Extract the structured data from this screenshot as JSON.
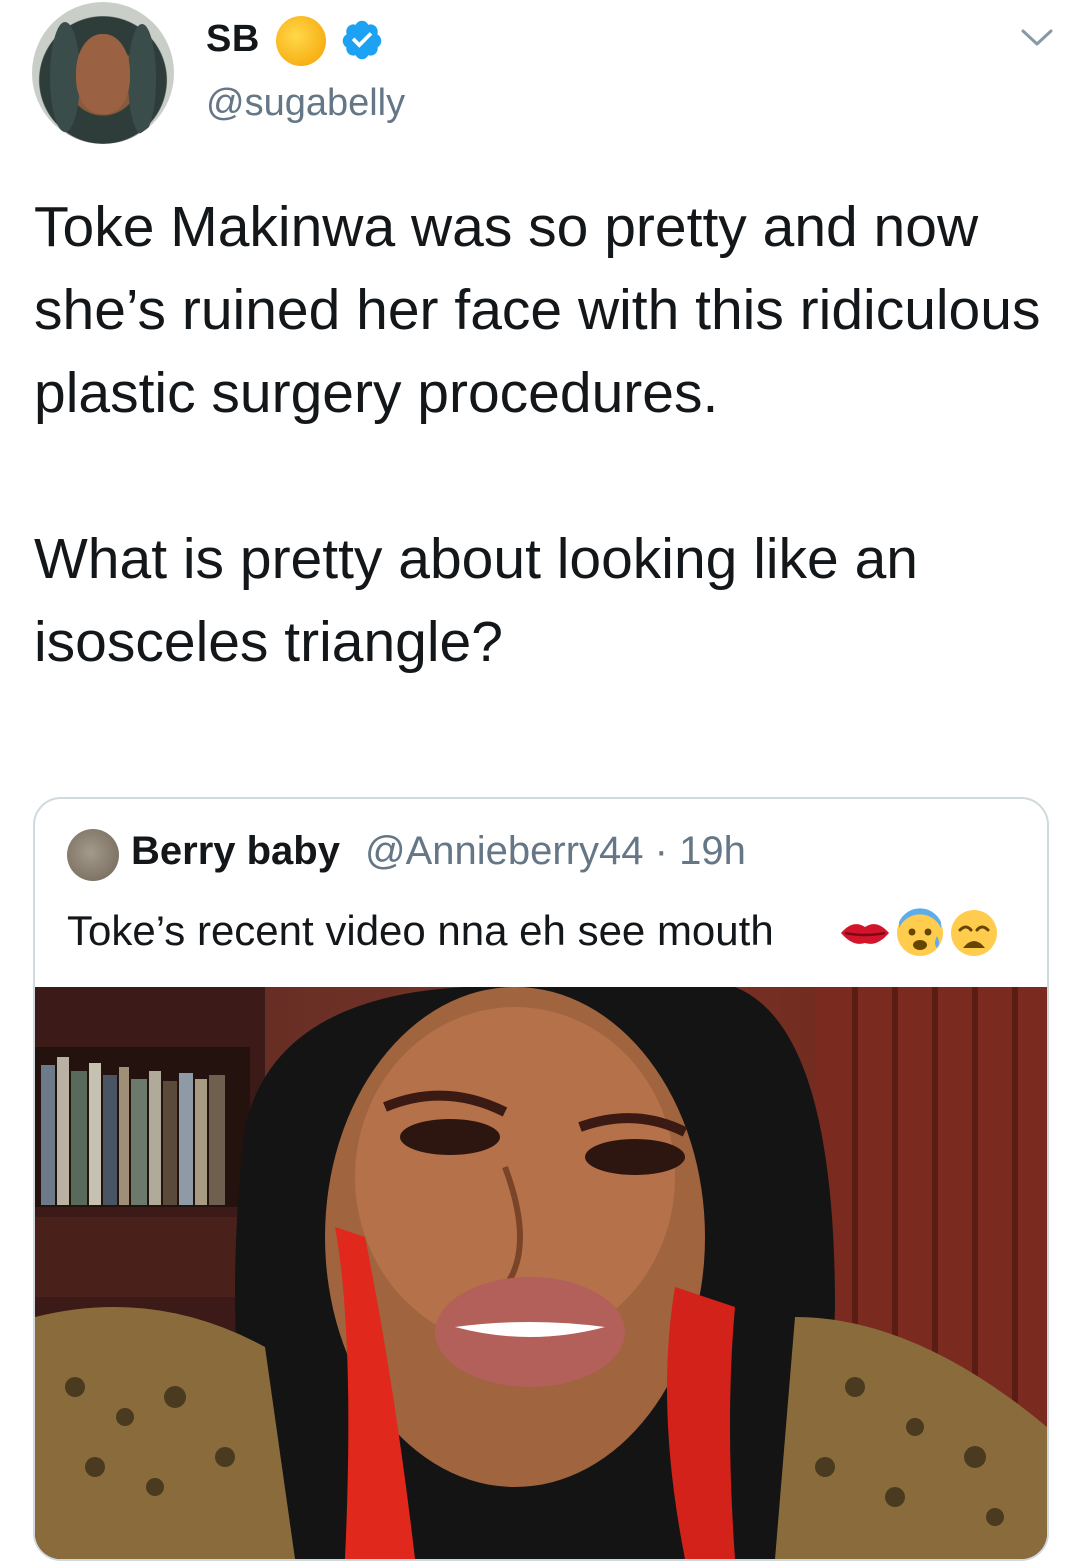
{
  "tweet": {
    "display_name": "SB",
    "handle": "@sugabelly",
    "text_para1": "Toke Makinwa was so pretty and now she’s ruined her face with this ridiculous plastic surgery procedures.",
    "text_para2": "What is pretty about looking like an isosceles triangle?",
    "icons": [
      "avatar-photo",
      "sun-badge-icon",
      "verified-icon",
      "chevron-down-icon"
    ]
  },
  "quote": {
    "display_name": "Berry baby",
    "handle_time": "@Annieberry44 · 19h",
    "text": "Toke’s recent video nna eh see mouth",
    "emojis": [
      "lips-emoji",
      "anxious-face-emoji",
      "weary-face-emoji"
    ],
    "media_icon": "video-still"
  },
  "colors": {
    "text": "#14171a",
    "secondary": "#657786",
    "verified": "#1da1f2",
    "border": "#cfd9de"
  }
}
